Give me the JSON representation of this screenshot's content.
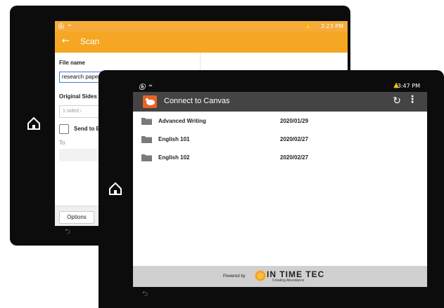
{
  "scan_screen": {
    "status_time": "3:23 PM",
    "title": "Scan",
    "file_name_label": "File name",
    "file_name_value": "research paper",
    "original_sides_label": "Original Sides",
    "original_sides_value": "1-sided",
    "send_to_email_label": "Send to Emai",
    "to_label": "To",
    "options_label": "Options"
  },
  "canvas_screen": {
    "status_time": "3:47 PM",
    "title": "Connect to Canvas",
    "folders": [
      {
        "name": "Advanced Writing",
        "date": "2020/01/29"
      },
      {
        "name": "English 101",
        "date": "2020/02/27"
      },
      {
        "name": "English 102",
        "date": "2020/02/27"
      }
    ],
    "footer": {
      "powered_by": "Powered by",
      "brand": "IN TIME TEC",
      "tagline": "Creating Abundance"
    }
  },
  "colors": {
    "scan_orange": "#f5a623",
    "canvas_header": "#444444",
    "canvas_logo": "#e86324"
  },
  "icons": [
    "home-icon",
    "back-arrow-icon",
    "warning-icon",
    "refresh-icon",
    "more-vertical-icon",
    "folder-icon",
    "wifi-icon"
  ]
}
